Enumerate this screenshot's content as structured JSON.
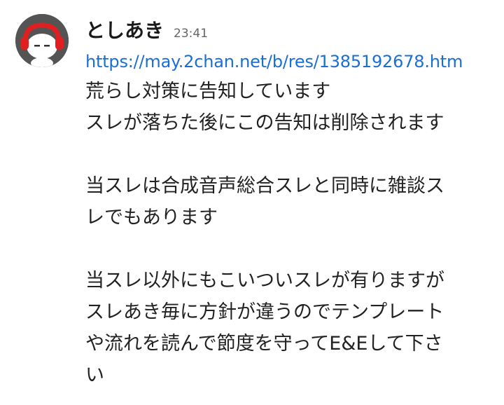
{
  "message": {
    "author": "としあき",
    "time": "23:41",
    "link": "https://may.2chan.net/b/res/1385192678.htm",
    "lines": [
      "荒らし対策に告知しています",
      "スレが落ちた後にこの告知は削除されます",
      "",
      "当スレは合成音声総合スレと同時に雑談ス",
      "レでもあります",
      "",
      "当スレ以外にもこいついスレが有りますが",
      "スレあき毎に方針が違うのでテンプレート",
      "や流れを読んで節度を守ってE&Eして下さ",
      "い"
    ]
  },
  "avatar": {
    "icon": "character-avatar-icon",
    "background": "#545454",
    "accent": "#e02020"
  },
  "colors": {
    "link": "#1a6fd6",
    "text": "#222222",
    "timestamp": "#666666"
  }
}
